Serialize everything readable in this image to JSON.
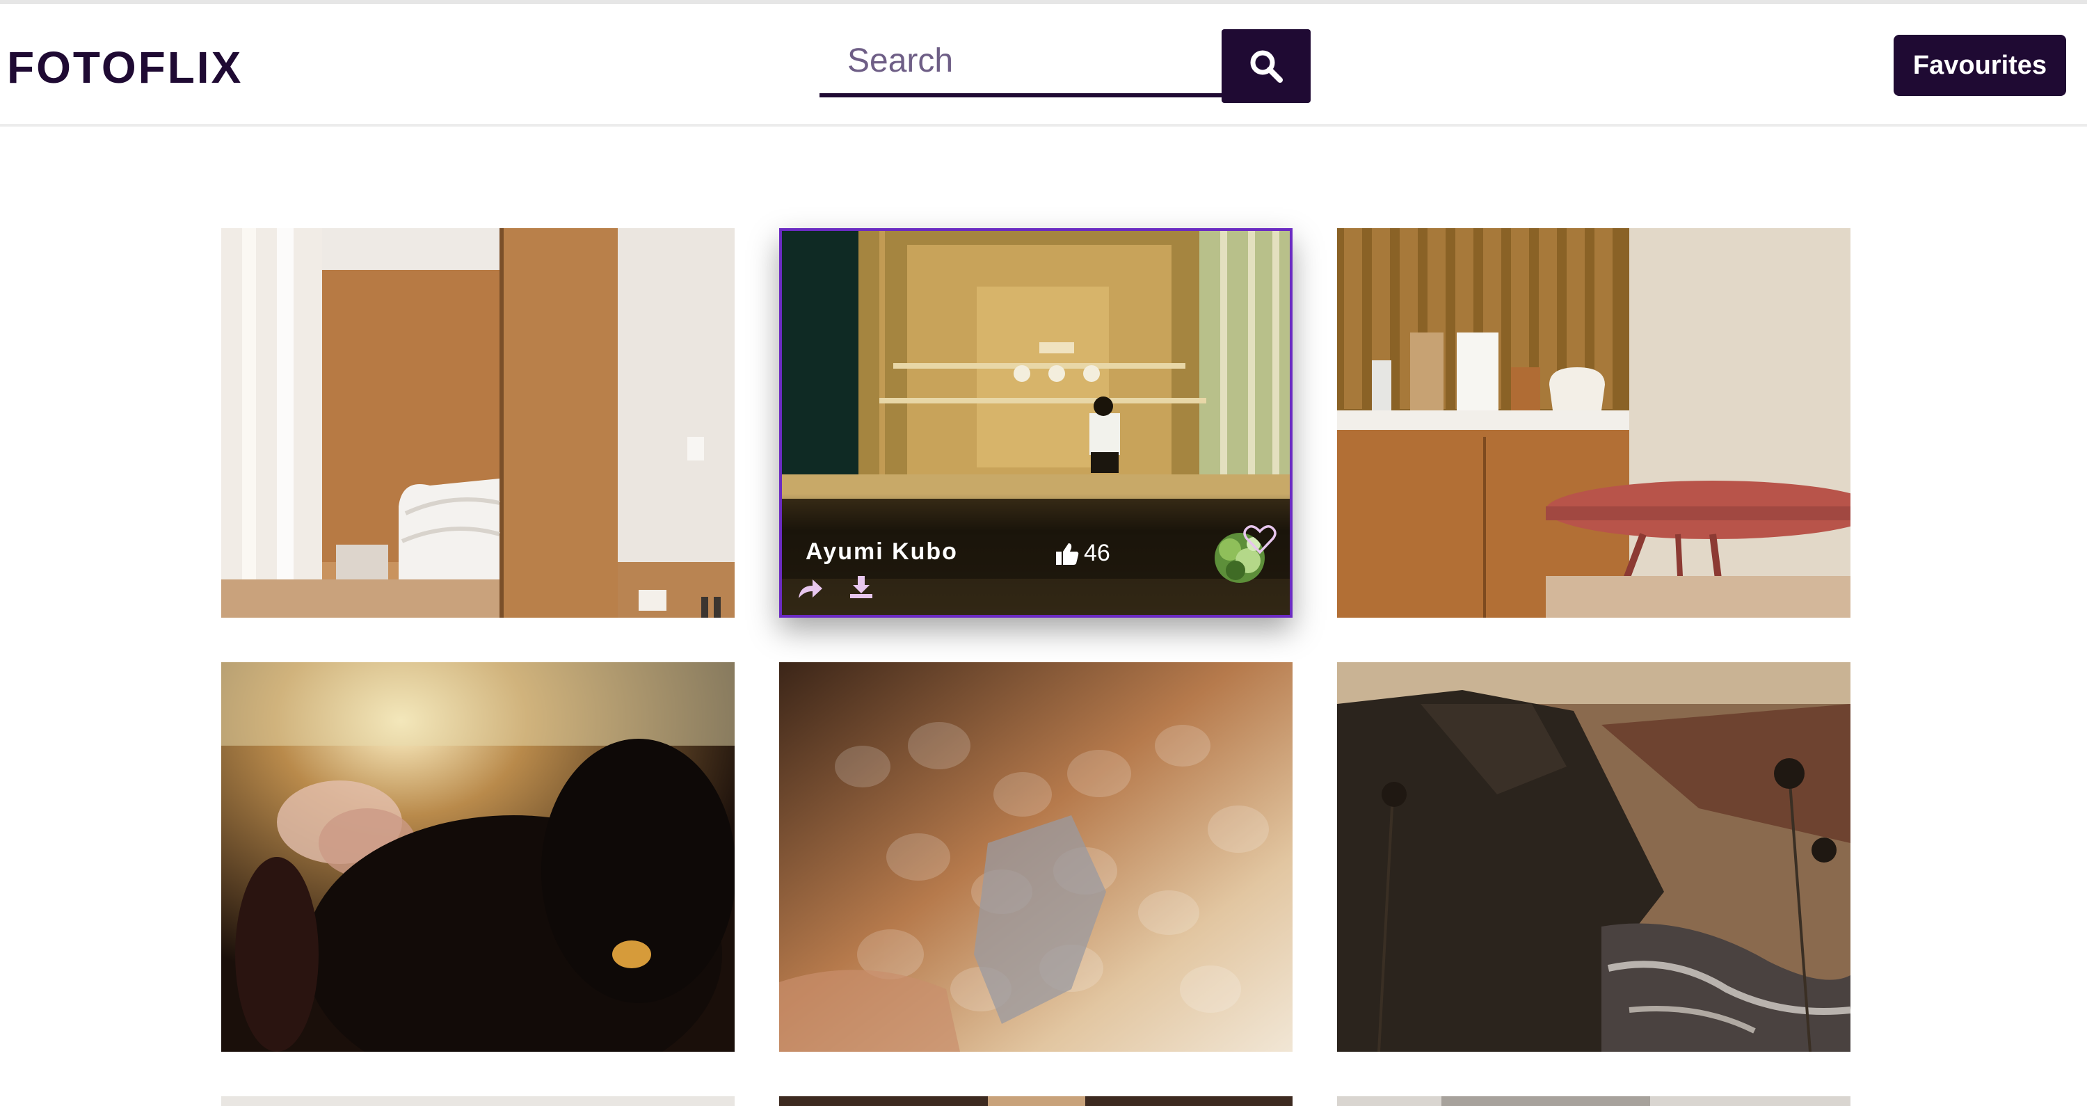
{
  "header": {
    "logo": "FOTOFLIX",
    "search_placeholder": "Search",
    "search_icon": "magnifier-icon",
    "favourites_label": "Favourites"
  },
  "colors": {
    "brand": "#1f0a33",
    "accent": "#6b2bc2",
    "placeholder": "#6e5e86",
    "icon_pink": "#e7c6ee"
  },
  "gallery": {
    "photos": [
      {
        "subject": "wood-paneled bedroom interior"
      },
      {
        "subject": "subway station entrance",
        "author": "Ayumi Kubo",
        "likes": "46",
        "hovered": true
      },
      {
        "subject": "kitchen counter with table"
      },
      {
        "subject": "blurred flower at sunset"
      },
      {
        "subject": "hammered metal texture"
      },
      {
        "subject": "rocky coast with waves"
      }
    ]
  }
}
